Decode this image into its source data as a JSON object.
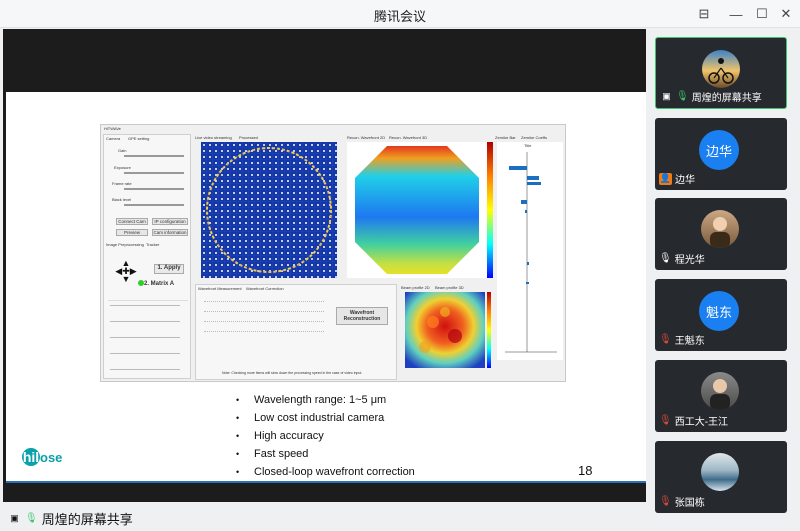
{
  "window": {
    "title": "腾讯会议",
    "controls": {
      "pin": "⊟",
      "minimize": "—",
      "maximize": "☐",
      "close": "✕"
    }
  },
  "share": {
    "bottom_label": "周煌的屏幕共享"
  },
  "slide": {
    "bullets": [
      "Wavelength range: 1~5 μm",
      "Low cost industrial camera",
      "High accuracy",
      "Fast speed",
      "Closed-loop wavefront correction"
    ],
    "page_number": "18",
    "logo_text": {
      "first": "hil",
      "rest": "ose"
    },
    "app_shot": {
      "window_title": "HiTWAVe",
      "tabs_left": [
        "Camera",
        "GPE setting"
      ],
      "tabs_center": [
        "Live video streaming",
        "Processed"
      ],
      "tabs_right": [
        "Recon. Wavefront 2D",
        "Recon. Wavefront 3D"
      ],
      "tabs_far_right": [
        "Zernike Bar",
        "Zernike Coeffs"
      ],
      "zernike_title": "Title",
      "labels": [
        "Gain",
        "Exposure",
        "Frame rate",
        "Black level"
      ],
      "buttons": [
        "Connect Cam",
        "IP configuration",
        "Preview",
        "Cam information"
      ],
      "apply_label": "1.   Apply",
      "matrix_label": "2.   Matrix A",
      "sub_tabs": [
        "Image Preprocessing",
        "Tracker"
      ],
      "wavefront_tabs": [
        "Wavefront Measurement",
        "Wavefront Correction"
      ],
      "beam_tabs": [
        "Beam profile 2D",
        "Beam profile 3D"
      ],
      "recon_button": "Wavefront Reconstruction",
      "note": "Note: Checking more items will slow down the processing speed in the case of video input."
    }
  },
  "participants": [
    {
      "name": "周煌的屏幕共享",
      "mic": "on",
      "type": "photo",
      "active": true,
      "icon": "screen-share-icon"
    },
    {
      "name": "边华",
      "mic": "none",
      "type": "circle",
      "avatar_text": "边华",
      "avatar_color": "#1a7ff0",
      "icon": "user-icon"
    },
    {
      "name": "程光华",
      "mic": "on-white",
      "type": "photo"
    },
    {
      "name": "王魁东",
      "mic": "off",
      "type": "circle",
      "avatar_text": "魁东",
      "avatar_color": "#1a7ff0"
    },
    {
      "name": "西工大-王江",
      "mic": "off",
      "type": "photo"
    },
    {
      "name": "张国栋",
      "mic": "off",
      "type": "photo"
    }
  ],
  "colors": {
    "accent_green": "#3bc46a",
    "slide_blue_line": "#2a6fb8",
    "logo_teal": "#0aa1a8",
    "mic_muted": "#e24a3b"
  }
}
